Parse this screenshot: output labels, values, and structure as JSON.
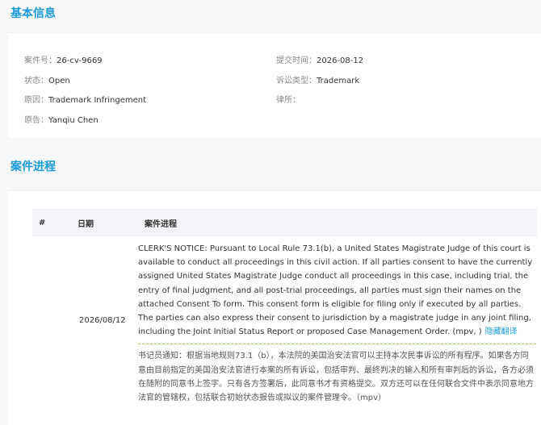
{
  "basic_info": {
    "section_title": "基本信息",
    "case_no_label": "案件号：",
    "case_no": "26-cv-9669",
    "filed_label": "提交时间：",
    "filed": "2026-08-12",
    "status_label": "状态：",
    "status": "Open",
    "type_label": "诉讼类型：",
    "type": "Trademark",
    "cause_label": "原因：",
    "cause": "Trademark Infringement",
    "firm_label": "律所：",
    "firm": "",
    "plaintiff_label": "原告：",
    "plaintiff": "Yanqiu Chen"
  },
  "progress": {
    "section_title": "案件进程",
    "headers": {
      "num": "#",
      "date": "日期",
      "entry": "案件进程"
    },
    "entries": [
      {
        "num": "",
        "date": "2026/08/12",
        "text_en": "CLERK'S NOTICE: Pursuant to Local Rule 73.1(b), a United States Magistrate Judge of this court is available to conduct all proceedings in this civil action. If all parties consent to have the currently assigned United States Magistrate Judge conduct all proceedings in this case, including trial, the entry of final judgment, and all post-trial proceedings, all parties must sign their names on the attached Consent To form. This consent form is eligible for filing only if executed by all parties. The parties can also express their consent to jurisdiction by a magistrate judge in any joint filing, including the Joint Initial Status Report or proposed Case Management Order. (mpv, )",
        "translate_label": "隐藏翻译",
        "text_cn": "书记员通知：根据当地规则73.1（b），本法院的美国治安法官可以主持本次民事诉讼的所有程序。如果各方同意由目前指定的美国治安法官进行本案的所有诉讼，包括审判、最终判决的输入和所有审判后的诉讼，各方必须在随附的同意书上签字。只有各方签署后，此同意书才有资格提交。双方还可以在任何联合文件中表示同意地方法官的管辖权，包括联合初始状态报告或拟议的案件管理令。（mpv）"
      }
    ]
  }
}
